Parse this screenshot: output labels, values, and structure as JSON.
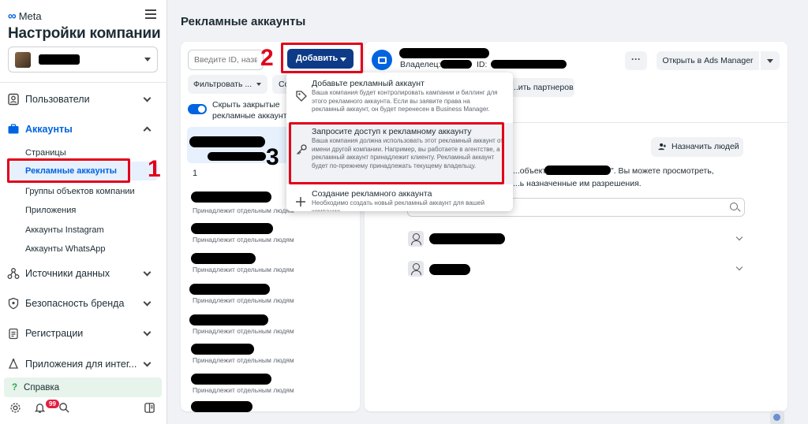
{
  "sidebar": {
    "brand": "Meta",
    "title": "Настройки компании",
    "nav": {
      "users": "Пользователи",
      "accounts": "Аккаунты",
      "data_sources": "Источники данных",
      "brand_safety": "Безопасность бренда",
      "registrations": "Регистрации",
      "integrations": "Приложения для интег..."
    },
    "accounts_sub": [
      "Страницы",
      "Рекламные аккаунты",
      "Группы объектов компании",
      "Приложения",
      "Аккаунты Instagram",
      "Аккаунты WhatsApp"
    ],
    "help": "Справка",
    "notification_count": "99"
  },
  "main": {
    "title": "Рекламные аккаунты",
    "search_placeholder": "Введите ID, назва...",
    "filter_label": "Фильтровать ...",
    "second_filter": "Со",
    "toggle_label": "Скрыть закрытые рекламные аккаунты",
    "list_number": "1",
    "owner_text": "Принадлежит отдельным людям"
  },
  "add_button": "Добавить",
  "dropdown": [
    {
      "title": "Добавьте рекламный аккаунт",
      "desc": "Ваша компания будет контролировать кампании и биллинг для этого рекламного аккаунта. Если вы заявите права на рекламный аккаунт, он будет перенесен в Business Manager.",
      "icon": "tag-icon"
    },
    {
      "title": "Запросите доступ к рекламному аккаунту",
      "desc": "Ваша компания должна использовать этот рекламный аккаунт от имени другой компании. Например, вы работаете в агентстве, а рекламный аккаунт принадлежит клиенту. Рекламный аккаунт будет по-прежнему принадлежать текущему владельцу.",
      "icon": "key-icon"
    },
    {
      "title": "Создание рекламного аккаунта",
      "desc": "Необходимо создать новый рекламный аккаунт для вашей компании",
      "icon": "plus-icon"
    }
  ],
  "detail": {
    "owner_label": "Владелец:",
    "id_label": "ID:",
    "more": "···",
    "open_ads_manager": "Открыть в Ads Manager",
    "partners_button": "...ить партнеров",
    "assign_people": "Назначить людей",
    "info_line1_start": "...объекту \"",
    "info_line1_end": "\". Вы можете просмотреть,",
    "info_line2": "...ь назначенные им разрешения."
  },
  "annotations": {
    "step1": "1",
    "step2": "2",
    "step3": "3"
  },
  "colors": {
    "accent": "#0064e0",
    "annotation_red": "#e1001a",
    "add_button": "#0d3b88"
  }
}
